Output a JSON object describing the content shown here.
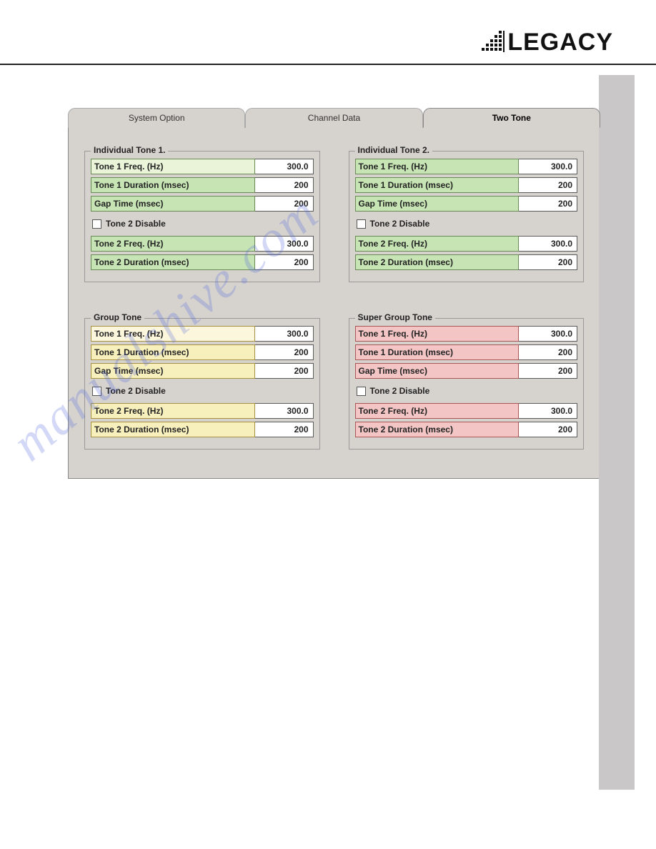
{
  "brand": "LEGACY",
  "watermark": "manualshive.com",
  "tabs": [
    {
      "label": "System Option",
      "active": false
    },
    {
      "label": "Channel Data",
      "active": false
    },
    {
      "label": "Two Tone",
      "active": true
    }
  ],
  "groups": {
    "ind1": {
      "legend": "Individual Tone 1.",
      "t1freq_label": "Tone 1 Freq. (Hz)",
      "t1freq": "300.0",
      "t1dur_label": "Tone 1 Duration (msec)",
      "t1dur": "200",
      "gap_label": "Gap Time (msec)",
      "gap": "200",
      "disable_label": "Tone 2 Disable",
      "t2freq_label": "Tone 2 Freq. (Hz)",
      "t2freq": "300.0",
      "t2dur_label": "Tone 2 Duration (msec)",
      "t2dur": "200"
    },
    "ind2": {
      "legend": "Individual Tone 2.",
      "t1freq_label": "Tone 1 Freq. (Hz)",
      "t1freq": "300.0",
      "t1dur_label": "Tone 1 Duration (msec)",
      "t1dur": "200",
      "gap_label": "Gap Time (msec)",
      "gap": "200",
      "disable_label": "Tone 2 Disable",
      "t2freq_label": "Tone 2 Freq. (Hz)",
      "t2freq": "300.0",
      "t2dur_label": "Tone 2 Duration (msec)",
      "t2dur": "200"
    },
    "group": {
      "legend": "Group Tone",
      "t1freq_label": "Tone 1 Freq. (Hz)",
      "t1freq": "300.0",
      "t1dur_label": "Tone 1 Duration (msec)",
      "t1dur": "200",
      "gap_label": "Gap Time (msec)",
      "gap": "200",
      "disable_label": "Tone 2 Disable",
      "t2freq_label": "Tone 2 Freq. (Hz)",
      "t2freq": "300.0",
      "t2dur_label": "Tone 2 Duration (msec)",
      "t2dur": "200"
    },
    "super": {
      "legend": "Super Group Tone",
      "t1freq_label": "Tone 1 Freq. (Hz)",
      "t1freq": "300.0",
      "t1dur_label": "Tone 1 Duration (msec)",
      "t1dur": "200",
      "gap_label": "Gap Time (msec)",
      "gap": "200",
      "disable_label": "Tone 2 Disable",
      "t2freq_label": "Tone 2 Freq. (Hz)",
      "t2freq": "300.0",
      "t2dur_label": "Tone 2 Duration (msec)",
      "t2dur": "200"
    }
  }
}
